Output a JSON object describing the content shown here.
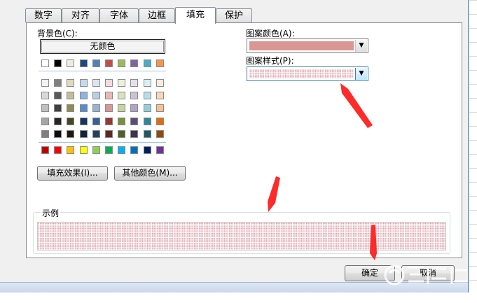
{
  "tabs": [
    {
      "label": "数字"
    },
    {
      "label": "对齐"
    },
    {
      "label": "字体"
    },
    {
      "label": "边框"
    },
    {
      "label": "填充",
      "active": true
    },
    {
      "label": "保护"
    }
  ],
  "background_color": {
    "label": "背景色(C):",
    "no_color_button": "无颜色",
    "theme_top_row": [
      "#ffffff",
      "#000000",
      "#eeece1",
      "#1f497d",
      "#4f81bd",
      "#c0504d",
      "#9bbb59",
      "#8064a2",
      "#4bacc6",
      "#f79646"
    ],
    "theme_tints": [
      [
        "#f2f2f2",
        "#7f7f7f",
        "#ddd9c3",
        "#c6d9f0",
        "#dbe5f1",
        "#f2dcdb",
        "#ebf1dd",
        "#e5e0ec",
        "#dbeef3",
        "#fdeada"
      ],
      [
        "#d8d8d8",
        "#595959",
        "#c4bd97",
        "#8db3e2",
        "#b8cce4",
        "#e5b9b7",
        "#d7e3bc",
        "#ccc1d9",
        "#b7dde8",
        "#fbd5b5"
      ],
      [
        "#bfbfbf",
        "#3f3f3f",
        "#938953",
        "#548dd4",
        "#95b3d7",
        "#d99694",
        "#c3d69b",
        "#b2a2c7",
        "#92cddc",
        "#fac08f"
      ],
      [
        "#a5a5a5",
        "#262626",
        "#494429",
        "#17365d",
        "#366092",
        "#953734",
        "#76923c",
        "#5f497a",
        "#31859b",
        "#e36c09"
      ],
      [
        "#7f7f7f",
        "#0c0c0c",
        "#1d1b10",
        "#0f243e",
        "#244061",
        "#632423",
        "#4f6128",
        "#3f3151",
        "#205867",
        "#974806"
      ]
    ],
    "standard_colors": [
      "#c00000",
      "#ff0000",
      "#ffc000",
      "#ffff00",
      "#92d050",
      "#00b050",
      "#00b0f0",
      "#0070c0",
      "#002060",
      "#7030a0"
    ],
    "fill_effects_button": "填充效果(I)...",
    "more_colors_button": "其他颜色(M)..."
  },
  "pattern": {
    "color_label": "图案颜色(A):",
    "color_value": "#da9694",
    "style_label": "图案样式(P):"
  },
  "sample": {
    "label": "示例"
  },
  "footer": {
    "ok_button": "确定",
    "cancel_button": "取消"
  },
  "annotation_color": "#ff2a2a"
}
